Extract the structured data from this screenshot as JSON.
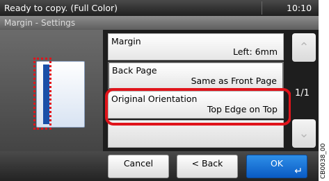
{
  "status": {
    "message": "Ready to copy. (Full Color)",
    "time": "10:10"
  },
  "title": "Margin - Settings",
  "settings": [
    {
      "label": "Margin",
      "value": "Left: 6mm"
    },
    {
      "label": "Back Page",
      "value": "Same as Front Page"
    },
    {
      "label": "Original Orientation",
      "value": "Top Edge on Top"
    }
  ],
  "pagination": "1/1",
  "buttons": {
    "cancel": "Cancel",
    "back": "< Back",
    "ok": "OK"
  },
  "image_code": "CB0038_00",
  "colors": {
    "highlight": "#e0141b",
    "ok_button": "#0a6fd6",
    "margin_strip": "#1a4fa8"
  },
  "icons": [
    "up-arrow-icon",
    "down-arrow-icon",
    "enter-icon"
  ]
}
